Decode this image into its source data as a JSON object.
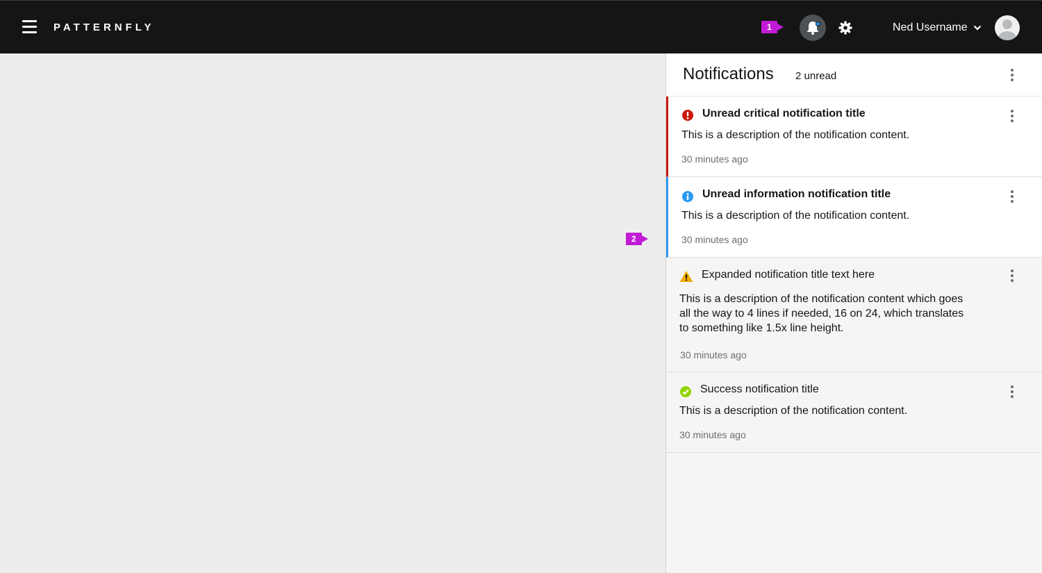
{
  "masthead": {
    "brand": "PATTERNFLY",
    "username": "Ned Username",
    "callout_1": "1",
    "icons": [
      "hamburger-icon",
      "bell-icon",
      "gear-icon",
      "chevron-down-icon",
      "avatar-icon"
    ]
  },
  "callout_2": "2",
  "drawer": {
    "title": "Notifications",
    "unread_count": "2 unread",
    "items": [
      {
        "variant": "critical",
        "state": "unread",
        "color": "#c9190b",
        "title": "Unread critical notification title",
        "description": "This is a description of the notification content.",
        "time": "30 minutes ago"
      },
      {
        "variant": "info",
        "state": "unread",
        "color": "#2b9af3",
        "title": "Unread information notification title",
        "description": "This is a description of the notification content.",
        "time": "30 minutes ago"
      },
      {
        "variant": "warning",
        "state": "read",
        "color": "#f0ab00",
        "title": "Expanded notification title text here",
        "description": "This is a description of the notification content which goes all the way to 4 lines if needed, 16 on 24, which translates to something like 1.5x line height.",
        "time": "30 minutes ago"
      },
      {
        "variant": "success",
        "state": "read",
        "color": "#92d400",
        "title": "Success notification title",
        "description": "This is a description of the notification content.",
        "time": "30 minutes ago"
      }
    ]
  }
}
